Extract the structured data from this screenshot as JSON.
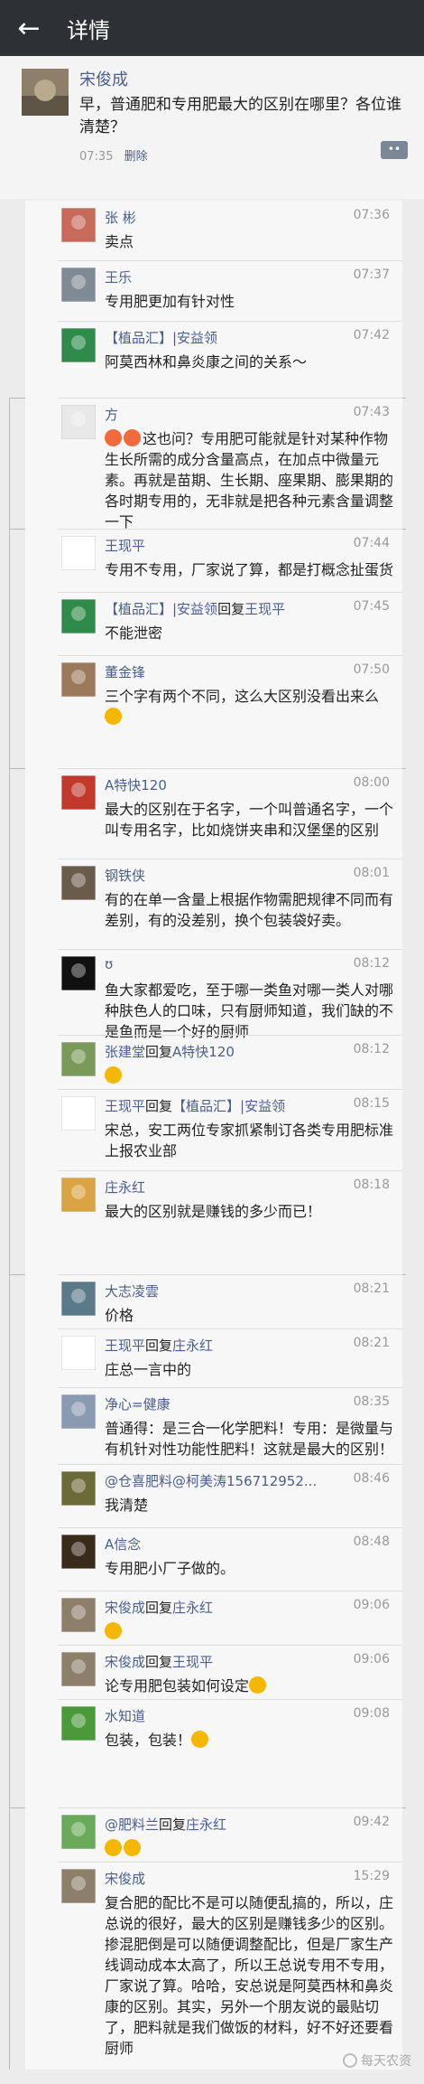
{
  "header": {
    "back": "←",
    "title": "详情"
  },
  "post": {
    "author": "宋俊成",
    "text": "早，普通肥和专用肥最大的区别在哪里？各位谁清楚？",
    "time": "07:35",
    "delete": "删除"
  },
  "comments": [
    {
      "name": "张 彬",
      "time": "07:36",
      "text": "卖点"
    },
    {
      "name": "王乐",
      "time": "07:37",
      "text": "专用肥更加有针对性"
    },
    {
      "name": "【植品汇】|安益领",
      "time": "07:42",
      "text": "阿莫西林和鼻炎康之间的关系～"
    },
    {
      "name": "方",
      "time": "07:43",
      "text": "这也问？专用肥可能就是针对某种作物生长所需的成分含量高点，在加点中微量元素。再就是苗期、生长期、座果期、膨果期的各时期专用的，无非就是把各种元素含量调整一下"
    },
    {
      "name": "王现平",
      "time": "07:44",
      "text": "专用不专用，厂家说了算，都是打概念扯蛋货"
    },
    {
      "name": "【植品汇】|安益领",
      "reply": "回复",
      "to": "王现平",
      "time": "07:45",
      "text": "不能泄密"
    },
    {
      "name": "董金锋",
      "time": "07:50",
      "text": "三个字有两个不同，这么大区别没看出来么"
    },
    {
      "name": "A特快120",
      "time": "08:00",
      "text": "最大的区别在于名字，一个叫普通名字，一个叫专用名字，比如烧饼夹串和汉堡堡的区别"
    },
    {
      "name": "钢铁侠",
      "time": "08:01",
      "text": "有的在单一含量上根据作物需肥规律不同而有差别，有的没差别，换个包装袋好卖。"
    },
    {
      "name": "ʊ",
      "time": "08:12",
      "text": "鱼大家都爱吃，至于哪一类鱼对哪一类人对哪种肤色人的口味，只有厨师知道，我们缺的不是鱼而是一个好的厨师"
    },
    {
      "name": "张建堂",
      "reply": "回复",
      "to": "A特快120",
      "time": "08:12",
      "text": ""
    },
    {
      "name": "王现平",
      "reply": "回复",
      "to": "【植品汇】|安益领",
      "time": "08:15",
      "text": "宋总，安工两位专家抓紧制订各类专用肥标准上报农业部"
    },
    {
      "name": "庄永红",
      "time": "08:18",
      "text": "最大的区别就是赚钱的多少而已！"
    },
    {
      "name": "大志凌雲",
      "time": "08:21",
      "text": "价格"
    },
    {
      "name": "王现平",
      "reply": "回复",
      "to": "庄永红",
      "time": "08:21",
      "text": "庄总一言中的"
    },
    {
      "name": "净心=健康",
      "time": "08:35",
      "text": "普通得：是三合一化学肥料！专用：是微量与有机针对性功能性肥料！这就是最大的区别！"
    },
    {
      "name": "@仓喜肥料@柯美涛156712952...",
      "time": "08:46",
      "text": "我清楚"
    },
    {
      "name": "A信念",
      "time": "08:48",
      "text": "专用肥小厂子做的。"
    },
    {
      "name": "宋俊成",
      "reply": "回复",
      "to": "庄永红",
      "time": "09:06",
      "text": ""
    },
    {
      "name": "宋俊成",
      "reply": "回复",
      "to": "王现平",
      "time": "09:06",
      "text": "论专用肥包装如何设定"
    },
    {
      "name": "水知道",
      "time": "09:08",
      "text": "包装，包装！"
    },
    {
      "name": "@肥料兰",
      "reply": "回复",
      "to": "庄永红",
      "time": "09:42",
      "text": ""
    },
    {
      "name": "宋俊成",
      "time": "15:29",
      "text": "复合肥的配比不是可以随便乱搞的，所以，庄总说的很好，最大的区别是赚钱多少的区别。掺混肥倒是可以随便调整配比，但是厂家生产线调动成本太高了，所以王总说专用不专用，厂家说了算。哈哈，安总说是阿莫西林和鼻炎康的区别。其实，另外一个朋友说的最贴切了，肥料就是我们做饭的材料，好不好还要看厨师"
    }
  ],
  "watermark": "每天农资",
  "colors": {
    "topbar": "#2e3134",
    "link": "#4b5e8c",
    "panel": "#f7f7f7"
  },
  "icons": [
    "back-arrow-icon",
    "comment-icon",
    "more-icon"
  ]
}
